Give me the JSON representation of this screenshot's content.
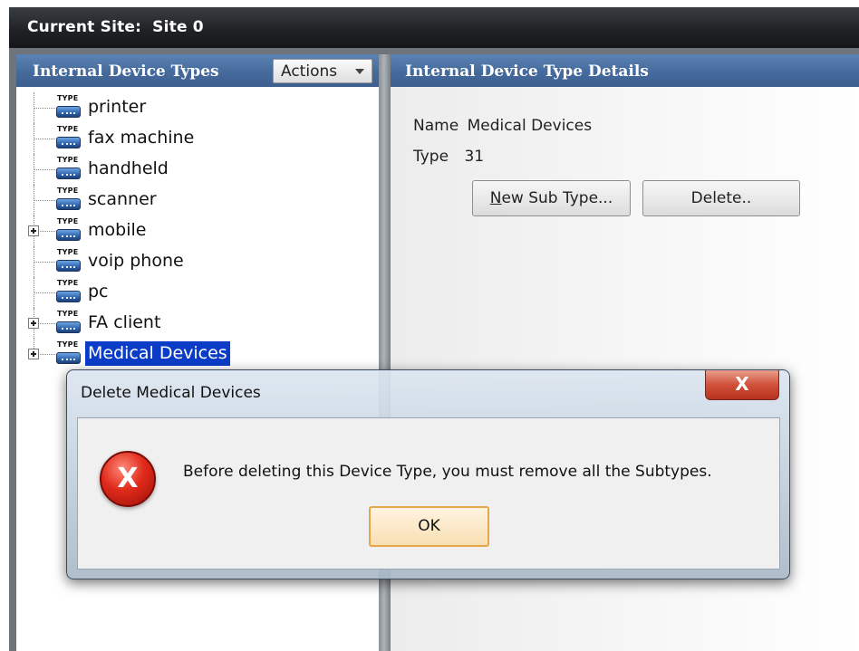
{
  "site_bar": {
    "label": "Current Site:",
    "value": "Site 0"
  },
  "left_panel": {
    "title": "Internal Device Types",
    "actions_label": "Actions",
    "tree": [
      {
        "label": "printer",
        "icon": "device-type-icon",
        "icon_tag": "TYPE",
        "expandable": false,
        "selected": false
      },
      {
        "label": "fax machine",
        "icon": "device-type-icon",
        "icon_tag": "TYPE",
        "expandable": false,
        "selected": false
      },
      {
        "label": "handheld",
        "icon": "device-type-icon",
        "icon_tag": "TYPE",
        "expandable": false,
        "selected": false
      },
      {
        "label": "scanner",
        "icon": "device-type-icon",
        "icon_tag": "TYPE",
        "expandable": false,
        "selected": false
      },
      {
        "label": "mobile",
        "icon": "device-type-icon",
        "icon_tag": "TYPE",
        "expandable": true,
        "selected": false
      },
      {
        "label": "voip phone",
        "icon": "device-type-icon",
        "icon_tag": "TYPE",
        "expandable": false,
        "selected": false
      },
      {
        "label": "pc",
        "icon": "device-type-icon",
        "icon_tag": "TYPE",
        "expandable": false,
        "selected": false
      },
      {
        "label": "FA client",
        "icon": "device-type-icon",
        "icon_tag": "TYPE",
        "expandable": true,
        "selected": false
      },
      {
        "label": "Medical Devices",
        "icon": "device-type-icon",
        "icon_tag": "TYPE",
        "expandable": true,
        "selected": true
      }
    ]
  },
  "right_panel": {
    "title": "Internal Device Type Details",
    "name_label": "Name",
    "name_value": "Medical Devices",
    "type_label": "Type",
    "type_value": "31",
    "new_subtype_accel": "N",
    "new_subtype_rest": "ew Sub Type...",
    "delete_label": "Delete.."
  },
  "dialog": {
    "title": "Delete Medical Devices",
    "close_label": "X",
    "icon": "error-icon",
    "icon_glyph": "X",
    "message": "Before deleting this Device Type, you must remove all the Subtypes.",
    "ok_label": "OK"
  },
  "colors": {
    "header_blue": "#456a9c",
    "selection_blue": "#0a3cc8",
    "error_red": "#e02a1a",
    "ok_border": "#e8a64a"
  }
}
